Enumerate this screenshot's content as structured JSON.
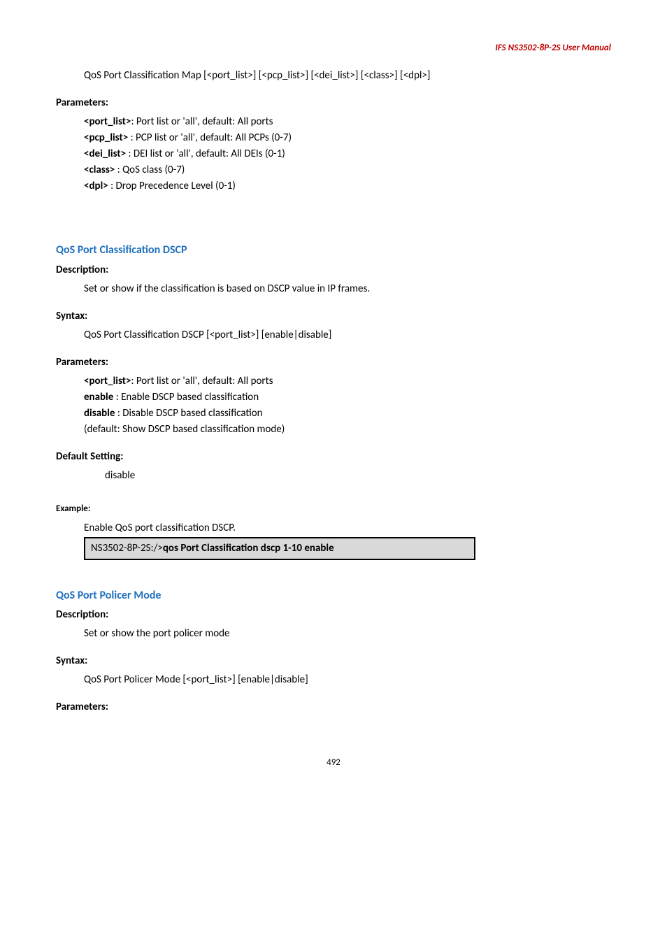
{
  "header": "IFS NS3502-8P-2S  User  Manual",
  "topSyntax": "QoS Port Classification Map [<port_list>] [<pcp_list>] [<dei_list>] [<class>] [<dpl>]",
  "labels": {
    "parameters": "Parameters:",
    "description": "Description:",
    "syntax": "Syntax:",
    "defaultSetting": "Default Setting:",
    "example": "Example:"
  },
  "topParams": [
    {
      "key": "<port_list>",
      "sep": ": ",
      "desc": "Port list or 'all', default: All ports"
    },
    {
      "key": "<pcp_list>",
      "sep": " : ",
      "desc": "PCP list or 'all', default: All PCPs (0-7)"
    },
    {
      "key": "<dei_list>",
      "sep": " : ",
      "desc": "DEI list or 'all', default: All DEIs (0-1)"
    },
    {
      "key": "<class>",
      "sep": "       : ",
      "desc": "QoS class (0-7)"
    },
    {
      "key": "<dpl>",
      "sep": "          : ",
      "desc": "Drop Precedence Level (0-1)"
    }
  ],
  "sectionDSCP": {
    "title": "QoS Port Classification DSCP",
    "descriptionText": "Set or show if the classification is based on DSCP value in IP frames.",
    "syntaxText": "QoS Port Classification DSCP [<port_list>] [enable|disable]",
    "params": [
      {
        "key": "<port_list>",
        "sep": ": ",
        "desc": "Port list or 'all', default: All ports"
      },
      {
        "key": "enable",
        "sep": "        : ",
        "desc": "Enable DSCP based classification"
      },
      {
        "key": "disable",
        "sep": "       : ",
        "desc": "Disable DSCP based classification"
      }
    ],
    "paramsNote": "(default: Show DSCP based classification mode)",
    "defaultValue": "disable",
    "exampleText": "Enable QoS port classification DSCP.",
    "codePrefix": "NS3502-8P-2S:/>",
    "codeCmd": "qos Port Classification dscp 1-10 enable"
  },
  "sectionPolicer": {
    "title": "QoS Port Policer Mode",
    "descriptionText": "Set or show the port policer mode",
    "syntaxText": "QoS Port Policer Mode [<port_list>] [enable|disable]"
  },
  "pageNumber": "492"
}
